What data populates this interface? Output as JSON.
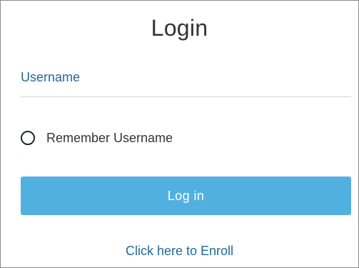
{
  "login": {
    "title": "Login",
    "username_placeholder": "Username",
    "username_value": "",
    "remember_label": "Remember Username",
    "remember_checked": false,
    "login_button_label": "Log in",
    "enroll_link_label": "Click here to Enroll"
  },
  "colors": {
    "accent": "#52b0e0",
    "link": "#1f6a95",
    "text": "#333333",
    "border": "#8a8a8a"
  },
  "icons": {
    "remember": "radio-unchecked-icon"
  }
}
